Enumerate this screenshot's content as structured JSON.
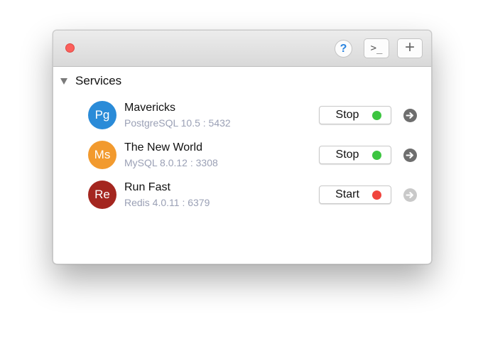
{
  "toolbar": {
    "help_glyph": "?",
    "terminal_glyph": ">_",
    "add_glyph": "+"
  },
  "section": {
    "title": "Services"
  },
  "services": [
    {
      "name": "Mavericks",
      "detail": "PostgreSQL 10.5 : 5432",
      "avatar_text": "Pg",
      "avatar_color": "#2a8bd8",
      "action_label": "Stop",
      "status": "running",
      "status_color": "#3cc540",
      "arrow_color": "#6e6e6e"
    },
    {
      "name": "The New World",
      "detail": "MySQL 8.0.12 : 3308",
      "avatar_text": "Ms",
      "avatar_color": "#f29a2e",
      "action_label": "Stop",
      "status": "running",
      "status_color": "#3cc540",
      "arrow_color": "#6e6e6e"
    },
    {
      "name": "Run Fast",
      "detail": "Redis 4.0.11 : 6379",
      "avatar_text": "Re",
      "avatar_color": "#a4261f",
      "action_label": "Start",
      "status": "stopped",
      "status_color": "#f0443d",
      "arrow_color": "#c9c9c9"
    }
  ],
  "colors": {
    "close_button": "#fc605c",
    "help_accent": "#2a84e0",
    "detail_text": "#9aa0b5"
  }
}
